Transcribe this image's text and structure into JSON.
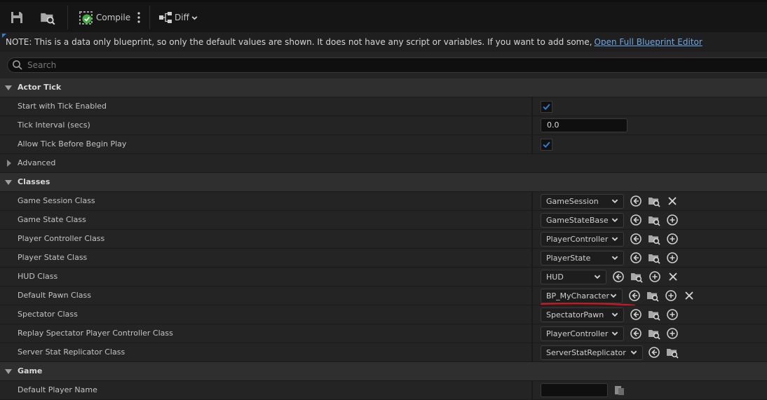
{
  "toolbar": {
    "save_icon": "save-icon",
    "browse_icon": "browse-icon",
    "compile_label": "Compile",
    "diff_label": "Diff"
  },
  "note": {
    "text": "NOTE: This is a data only blueprint, so only the default values are shown.  It does not have any script or variables.  If you want to add some,",
    "link": "Open Full Blueprint Editor"
  },
  "search": {
    "placeholder": "Search"
  },
  "actor_tick": {
    "title": "Actor Tick",
    "start_with_tick": {
      "label": "Start with Tick Enabled",
      "checked": true
    },
    "tick_interval": {
      "label": "Tick Interval (secs)",
      "value": "0.0"
    },
    "allow_tick": {
      "label": "Allow Tick Before Begin Play",
      "checked": true
    },
    "advanced": "Advanced"
  },
  "classes": {
    "title": "Classes",
    "game_session": {
      "label": "Game Session Class",
      "value": "GameSession"
    },
    "game_state": {
      "label": "Game State Class",
      "value": "GameStateBase"
    },
    "player_controller": {
      "label": "Player Controller Class",
      "value": "PlayerController"
    },
    "player_state": {
      "label": "Player State Class",
      "value": "PlayerState"
    },
    "hud": {
      "label": "HUD Class",
      "value": "HUD"
    },
    "default_pawn": {
      "label": "Default Pawn Class",
      "value": "BP_MyCharacter"
    },
    "spectator": {
      "label": "Spectator Class",
      "value": "SpectatorPawn"
    },
    "replay_spectator": {
      "label": "Replay Spectator Player Controller Class",
      "value": "PlayerController"
    },
    "server_stat": {
      "label": "Server Stat Replicator Class",
      "value": "ServerStatReplicator"
    }
  },
  "game": {
    "title": "Game",
    "default_player_name": {
      "label": "Default Player Name"
    }
  },
  "colors": {
    "checkbox_accent": "#2f7fd6",
    "link": "#6fa7e6",
    "annotation_line": "#d4141e",
    "compile_ok": "#3fae3f"
  }
}
